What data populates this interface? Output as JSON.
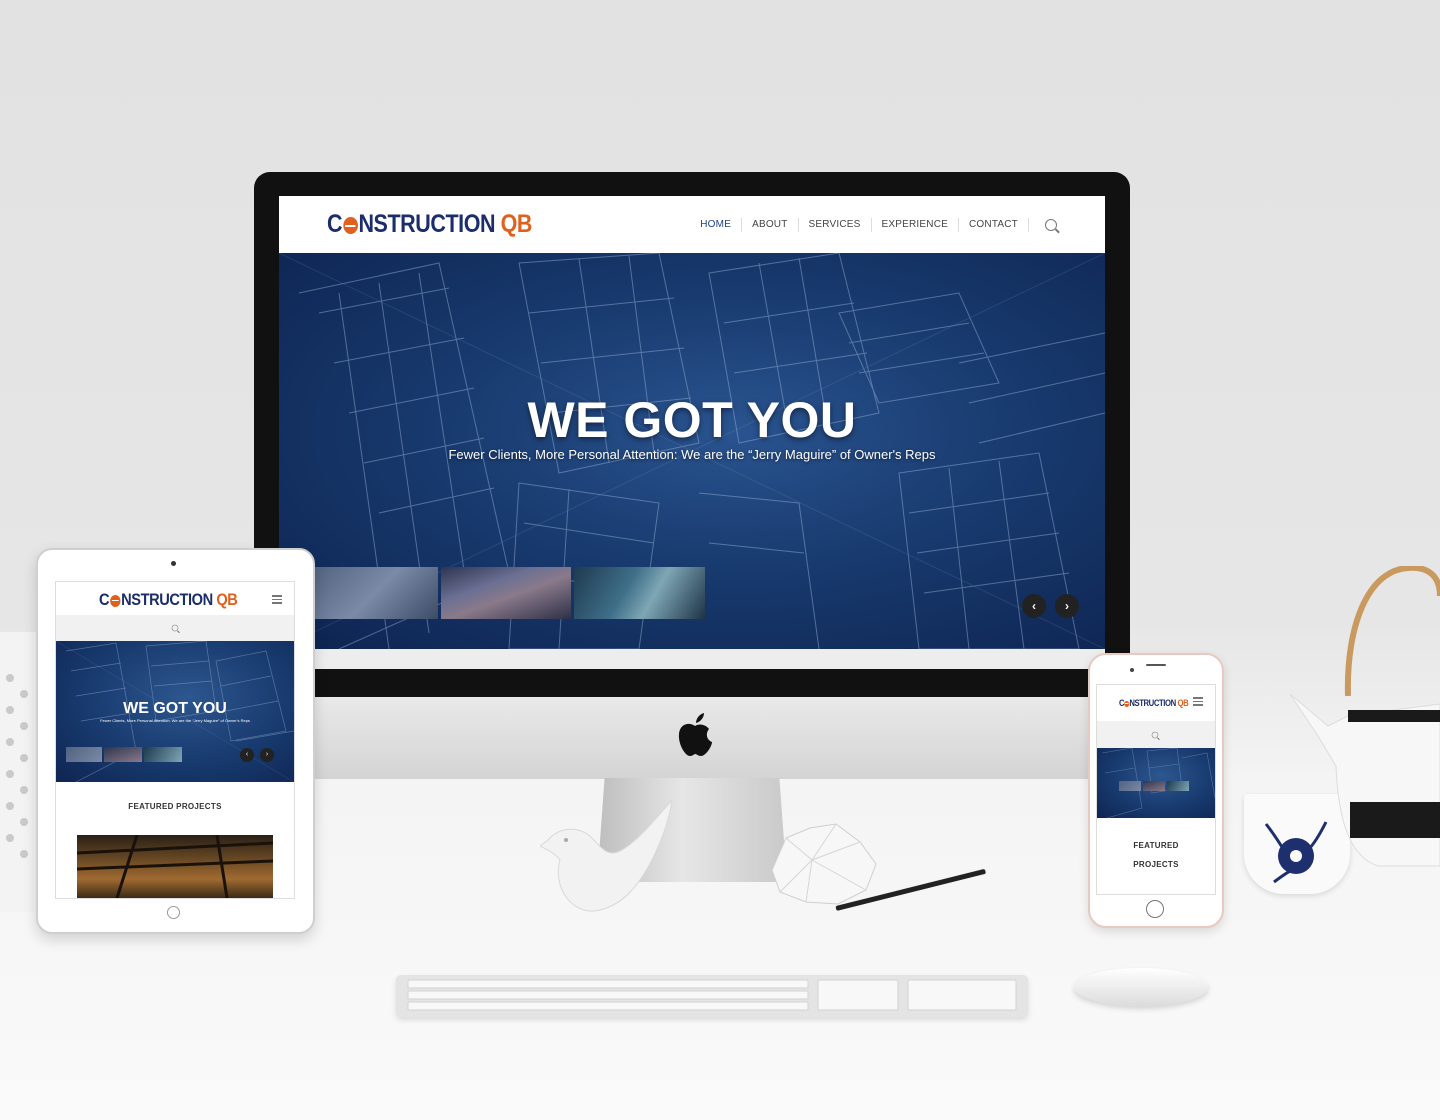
{
  "brand": {
    "logo_part1_a": "C",
    "logo_part1_b": "NSTRUCTION",
    "logo_part2": "QB",
    "color_primary": "#1c2d6b",
    "color_accent": "#e0601d"
  },
  "nav": {
    "items": [
      "HOME",
      "ABOUT",
      "SERVICES",
      "EXPERIENCE",
      "CONTACT"
    ],
    "active": "HOME",
    "search_icon": "search-icon"
  },
  "hero": {
    "title": "WE GOT YOU",
    "subtitle": "Fewer Clients, More Personal Attention: We are the “Jerry Maguire” of Owner's Reps",
    "prev_symbol": "‹",
    "next_symbol": "›"
  },
  "sections": {
    "featured_projects": "FEATURED PROJECTS",
    "featured_line1": "FEATURED",
    "featured_line2": "PROJECTS"
  }
}
